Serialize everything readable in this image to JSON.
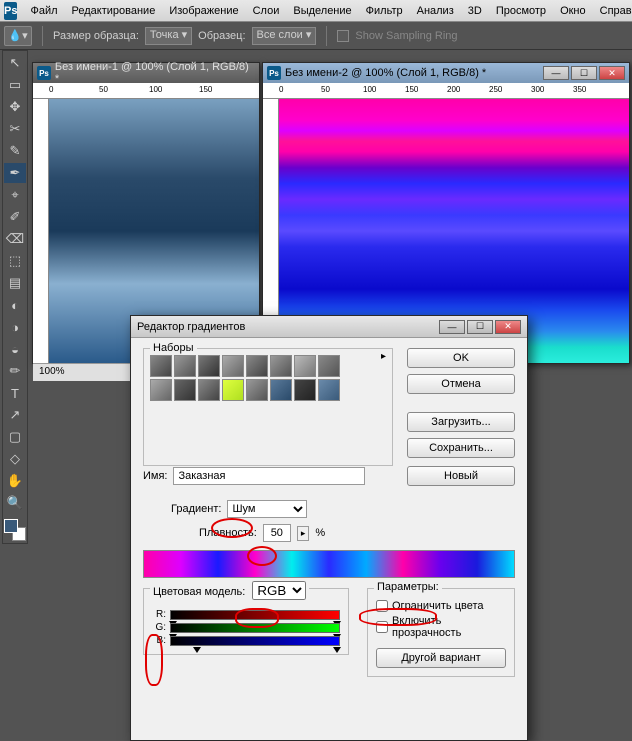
{
  "app": {
    "logo": "Ps"
  },
  "menu": [
    "Файл",
    "Редактирование",
    "Изображение",
    "Слои",
    "Выделение",
    "Фильтр",
    "Анализ",
    "3D",
    "Просмотр",
    "Окно",
    "Справка"
  ],
  "options": {
    "sample_size_label": "Размер образца:",
    "sample_size_value": "Точка",
    "sample_label": "Образец:",
    "sample_value": "Все слои",
    "show_ring": "Show Sampling Ring"
  },
  "tools": [
    "↖",
    "▭",
    "✥",
    "✂",
    "✎",
    "✒",
    "⌖",
    "✐",
    "⌫",
    "⬚",
    "▤",
    "◐",
    "◑",
    "◒",
    "✏",
    "T",
    "↗",
    "▢",
    "◇",
    "✋",
    "🔍"
  ],
  "doc1": {
    "title": "Без имени-1 @ 100% (Слой 1, RGB/8) *",
    "zoom": "100%",
    "ruler": [
      "0",
      "50",
      "100",
      "150"
    ]
  },
  "doc2": {
    "title": "Без имени-2 @ 100% (Слой 1, RGB/8) *",
    "ruler": [
      "0",
      "50",
      "100",
      "150",
      "200",
      "250",
      "300",
      "350"
    ]
  },
  "ge": {
    "title": "Редактор градиентов",
    "presets_label": "Наборы",
    "ok": "OK",
    "cancel": "Отмена",
    "load": "Загрузить...",
    "save": "Сохранить...",
    "new": "Новый",
    "name_label": "Имя:",
    "name_value": "Заказная",
    "gradient_label": "Градиент:",
    "gradient_type": "Шум",
    "rough_label": "Плавность:",
    "rough_value": "50",
    "rough_unit": "%",
    "colormodel_label": "Цветовая модель:",
    "colormodel_value": "RGB",
    "params_label": "Параметры:",
    "restrict": "Ограничить цвета",
    "transparency": "Включить прозрачность",
    "randomize": "Другой вариант",
    "channels": [
      "R:",
      "G:",
      "B:"
    ]
  },
  "preset_colors": [
    "linear-gradient(135deg,#888,#444)",
    "linear-gradient(135deg,#999,#555)",
    "linear-gradient(135deg,#777,#333)",
    "linear-gradient(135deg,#aaa,#666)",
    "linear-gradient(135deg,#888,#444)",
    "linear-gradient(135deg,#999,#555)",
    "linear-gradient(135deg,#bbb,#777)",
    "linear-gradient(135deg,#888,#555)",
    "linear-gradient(135deg,#aaa,#666)",
    "linear-gradient(135deg,#666,#333)",
    "linear-gradient(135deg,#888,#444)",
    "linear-gradient(135deg,#dfff40,#afdf20)",
    "linear-gradient(135deg,#999,#555)",
    "linear-gradient(135deg,#5a7a9a,#2a4a6a)",
    "linear-gradient(135deg,#444,#222)",
    "linear-gradient(135deg,#6a8aaa,#3a5a7a)"
  ]
}
